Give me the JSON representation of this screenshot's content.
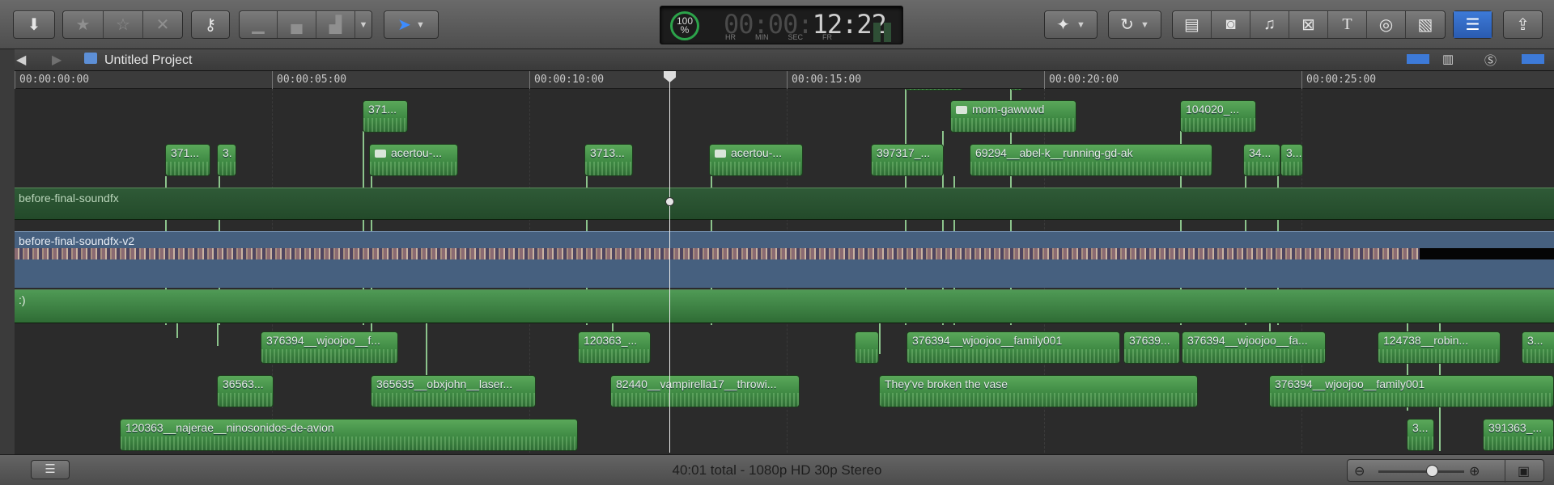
{
  "toolbar": {
    "import_icon": "download-arrow-icon",
    "rating_icons": [
      "favorite-star-icon",
      "unrate-star-icon",
      "reject-x-icon"
    ],
    "keyword_icon": "key-icon",
    "edit_icons": [
      "connect-clip-icon",
      "insert-clip-icon",
      "append-clip-icon"
    ],
    "tool_icon": "arrow-select-icon",
    "enhance_icon": "magic-wand-icon",
    "retime_icon": "retime-icon",
    "browser_icons": [
      "photo-browser-icon",
      "camera-icon",
      "music-icon",
      "transition-icon",
      "title-icon",
      "generator-icon",
      "theme-icon"
    ],
    "inspector_icon": "inspector-toggle-icon",
    "share_icon": "share-icon"
  },
  "timecode": {
    "percent": "100",
    "percent_sign": "%",
    "dim_digits": "00:00:",
    "bright_digits": "12:22",
    "labels": [
      "HR",
      "MIN",
      "SEC",
      "FR"
    ]
  },
  "project": {
    "title": "Untitled Project",
    "back_icon": "back-arrow-icon",
    "forward_icon": "forward-arrow-icon",
    "clapper_icon": "clapperboard-icon"
  },
  "ruler": {
    "ticks": [
      "00:00:00:00",
      "00:00:05:00",
      "00:00:10:00",
      "00:00:15:00",
      "00:00:20:00",
      "00:00:25:00"
    ]
  },
  "clips": {
    "c_371a": "371...",
    "c_371b": "371...",
    "c_3": "3.",
    "c_acertou1": "acertou-...",
    "c_3713": "3713...",
    "c_acertou2": "acertou-...",
    "c_397317": "397317_...",
    "c_mom": "mom-gawwwd",
    "c_69294": "69294__abel-k__running-gd-ak",
    "c_104020": "104020_...",
    "c_34": "34...",
    "c_3b": "3...",
    "storyline_top": "before-final-soundfx",
    "primary": "before-final-soundfx-v2",
    "storyline_smile": ":)",
    "c_376394a": "376394__wjoojoo__f...",
    "c_120363a": "120363_...",
    "c_376394b": "376394__wjoojoo__family001",
    "c_37639": "37639...",
    "c_376394c": "376394__wjoojoo__fa...",
    "c_124738": "124738__robin...",
    "c_3c": "3...",
    "c_36563": "36563...",
    "c_365635": "365635__obxjohn__laser...",
    "c_82440": "82440__vampirella17__throwi...",
    "c_broken": "They've broken the vase",
    "c_376394d": "376394__wjoojoo__family001",
    "c_120363b": "120363__najerae__ninosonidos-de-avion",
    "c_3d": "3...",
    "c_391363": "391363_..."
  },
  "status": {
    "text": "40:01 total - 1080p HD 30p Stereo",
    "list_icon": "timeline-index-icon",
    "zoom_out_icon": "zoom-out-icon",
    "zoom_in_icon": "zoom-in-icon",
    "clip_appearance_icon": "clip-appearance-icon",
    "zoom_level": 0.62
  },
  "colors": {
    "accent_blue": "#3d7ad8",
    "audio_green": "#3f8a44",
    "primary_blue": "#46607f"
  }
}
